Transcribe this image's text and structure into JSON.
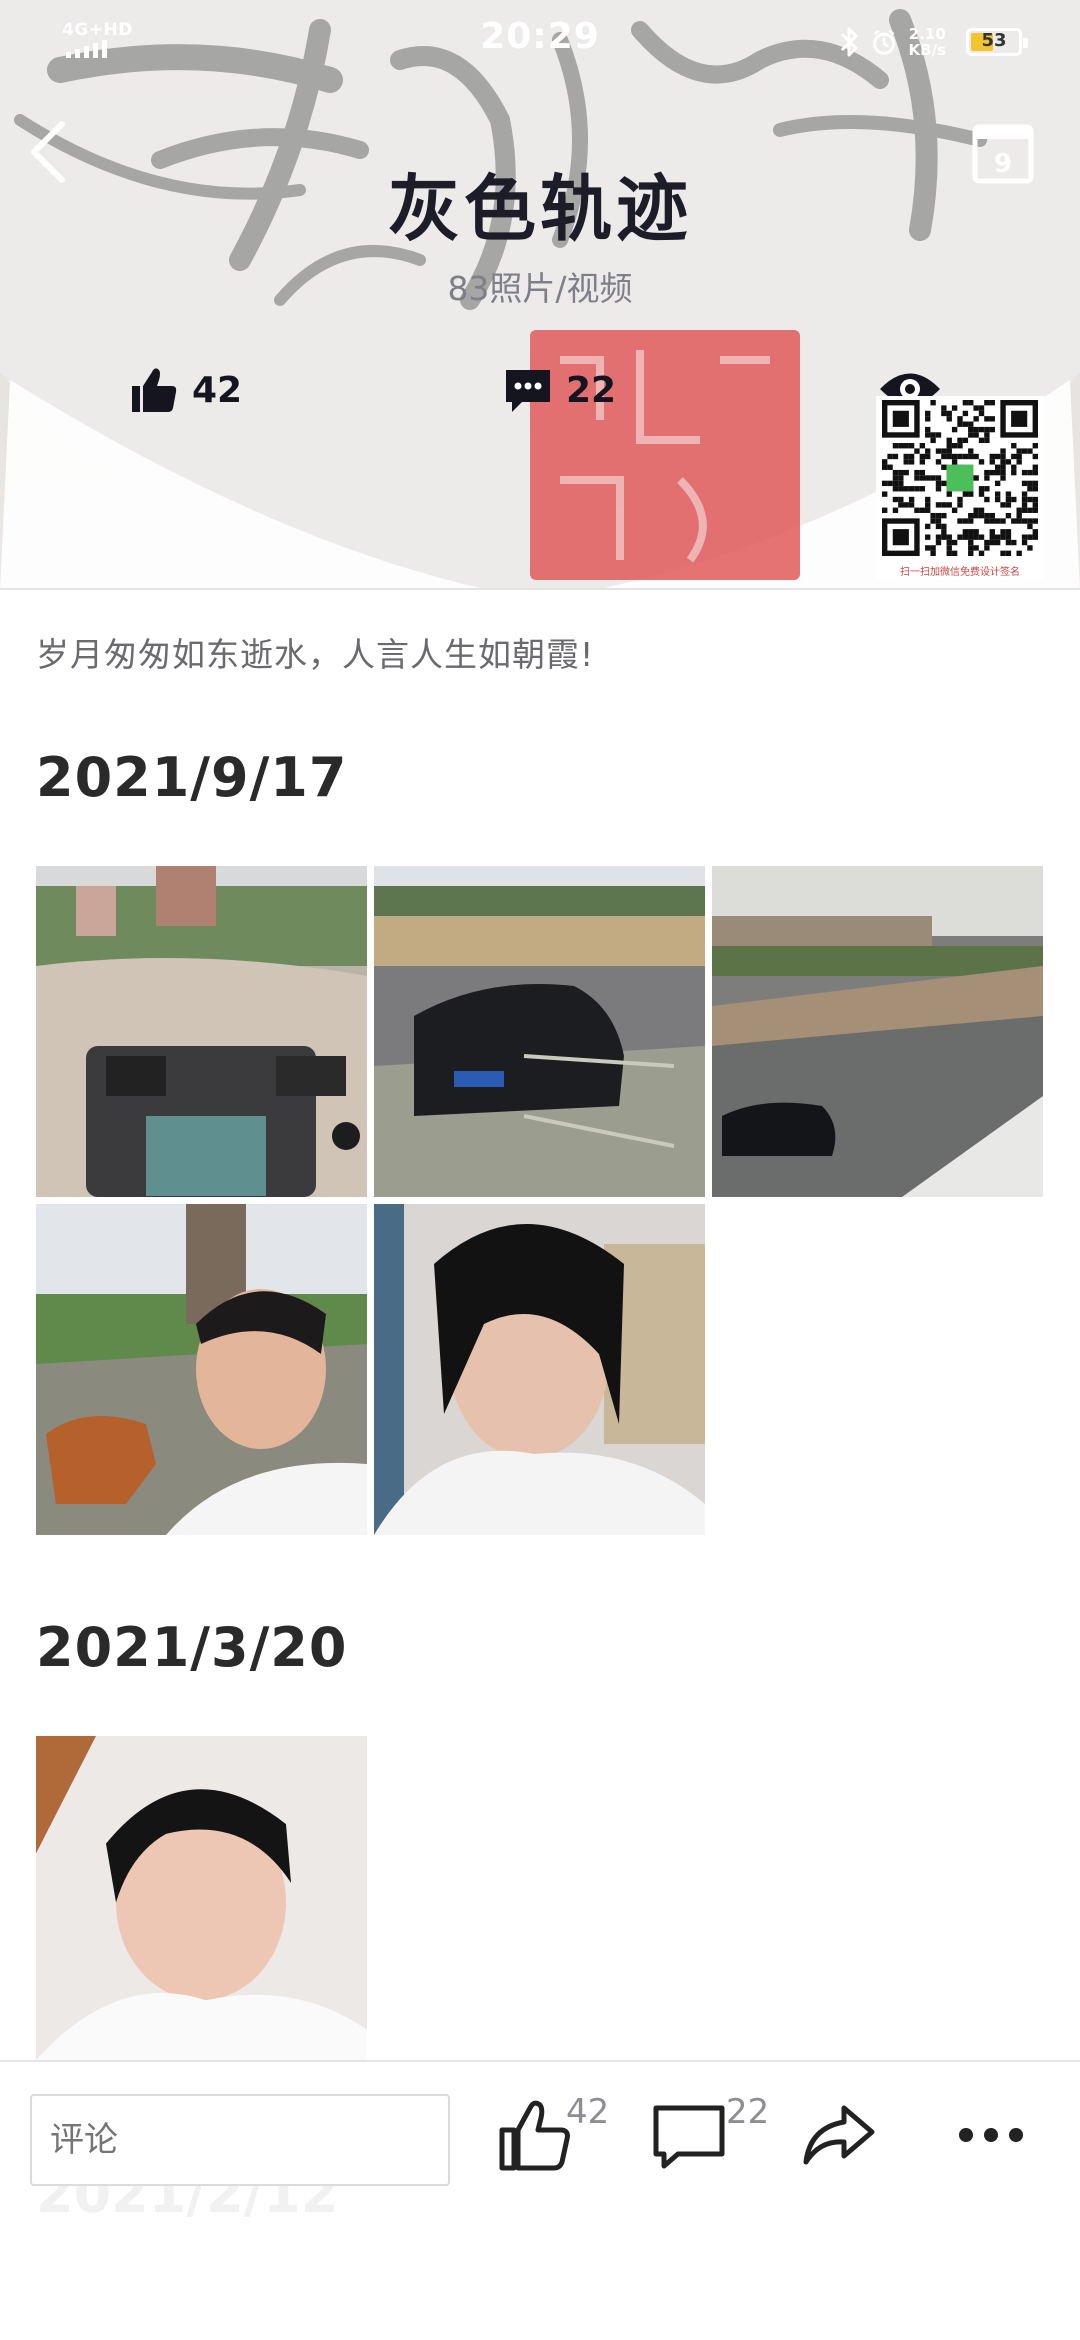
{
  "status_bar": {
    "network": "4G+HD",
    "time": "20:29",
    "speed_value": "2.10",
    "speed_unit": "KB/s",
    "battery": "53",
    "battery_level_percent": 53,
    "icons": [
      "bluetooth-icon",
      "alarm-icon"
    ]
  },
  "header": {
    "title": "灰色轨迹",
    "count_label": "83照片/视频",
    "calendar_day": "9",
    "like_count": "42",
    "comment_count": "22",
    "icons": [
      "back-icon",
      "calendar-icon",
      "thumbs-up-icon",
      "comment-icon",
      "eye-icon"
    ],
    "qr_caption": "扫一扫加微信免费设计签名"
  },
  "description": "岁月匆匆如东逝水，人言人生如朝霞!",
  "sections": [
    {
      "date": "2021/9/17",
      "photos": [
        "car-dashboard-photo",
        "parked-sedan-photo",
        "rainy-villa-street-photo",
        "selfie-with-dog-photo",
        "selfie-long-hair-photo"
      ]
    },
    {
      "date": "2021/3/20",
      "photos": [
        "selfie-close-up-photo"
      ]
    }
  ],
  "next_section_date": "2021/2/12",
  "bottom_bar": {
    "comment_placeholder": "评论",
    "like_count": "42",
    "comment_count": "22",
    "icons": [
      "thumbs-up-outline-icon",
      "comment-outline-icon",
      "share-icon",
      "more-icon"
    ]
  },
  "colors": {
    "title": "#1d1d2a",
    "muted_text": "#7f7f8a",
    "battery": "#f4c430",
    "seal_red": "#e25a5a"
  }
}
